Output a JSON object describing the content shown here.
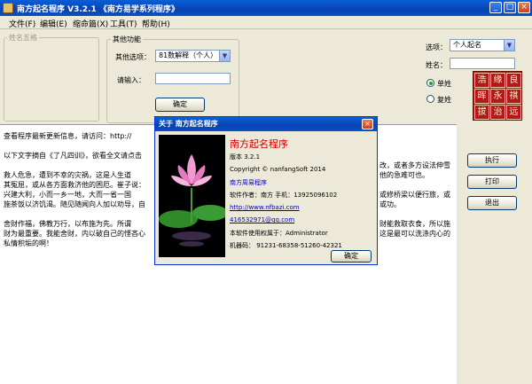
{
  "window": {
    "title": "南方起名程序  V3.2.1  《南方易学系列程序》",
    "min_glyph": "_",
    "max_glyph": "□",
    "close_glyph": "×"
  },
  "menu": [
    "文件(F)",
    "编辑(E)",
    "缩命篇(X)",
    "工具(T)",
    "帮助(H)"
  ],
  "left_group": {
    "title": "姓名五格"
  },
  "other_group": {
    "title": "其他功能",
    "option_label": "其他选项：",
    "option_value": "81数解释（个人）",
    "input_label": "请输入：",
    "input_value": "",
    "confirm_label": "确定"
  },
  "right_panel": {
    "option_label": "选项：",
    "option_value": "个人起名",
    "surname_label": "姓名：",
    "surname_value": "",
    "radio_single": "单姓",
    "radio_double": "复姓",
    "radio_selected": "单姓",
    "seal_chars": [
      "浩",
      "缘",
      "良",
      "晖",
      "永",
      "祺",
      "拔",
      "治",
      "远"
    ],
    "execute_label": "执行",
    "print_label": "打印",
    "exit_label": "退出"
  },
  "text_area": {
    "lines": [
      "查看程序最新更新信息，请访问：http://",
      "以下文字摘自《了凡四训》，欲看全文请点击",
      "    救人危急，遭到不幸的灾祸，这是人生道",
      "其冤屈，或从各方面救济他的困厄。崔子说：",
      "    兴建大利，小而一乡一地，大而一省一国",
      "施茶饭以济饥渴。随见随闻向人加以劝导，自",
      "    舍财作福，佛教万行，以布施为先。所谓",
      "财为最重要。我能舍财，内以破自己的悭吝心",
      "私情积垢的啊！"
    ],
    "right_fragments": [
      "改，或者多方设法伸雪",
      "他的急难可也。",
      "或修桥梁以便行旅，或",
      "或功。",
      "财能救取衣食，所以施",
      "这是最可以洗涤内心的"
    ],
    "url": "http://"
  },
  "dialog": {
    "title": "关于 南方起名程序",
    "close_glyph": "×",
    "app_name": "南方起名程序",
    "version": "版本 3.2.1",
    "copyright": "Copyright © nanfangSoft 2014",
    "company": "南方周易程序",
    "author": "软件作者：南方    手机：13925096102",
    "website": "http://www.nfbazi.com",
    "email": "416532971@qq.com",
    "licensee": "本软件使用权属于：Administrator",
    "machine_code": "机器码：  91231-68358-51260-42321",
    "ok_label": "确定"
  },
  "colors": {
    "titlebar": "#0842b0",
    "app_name": "#cc0000",
    "seal": "#b01a1a",
    "link": "#0000cc"
  }
}
